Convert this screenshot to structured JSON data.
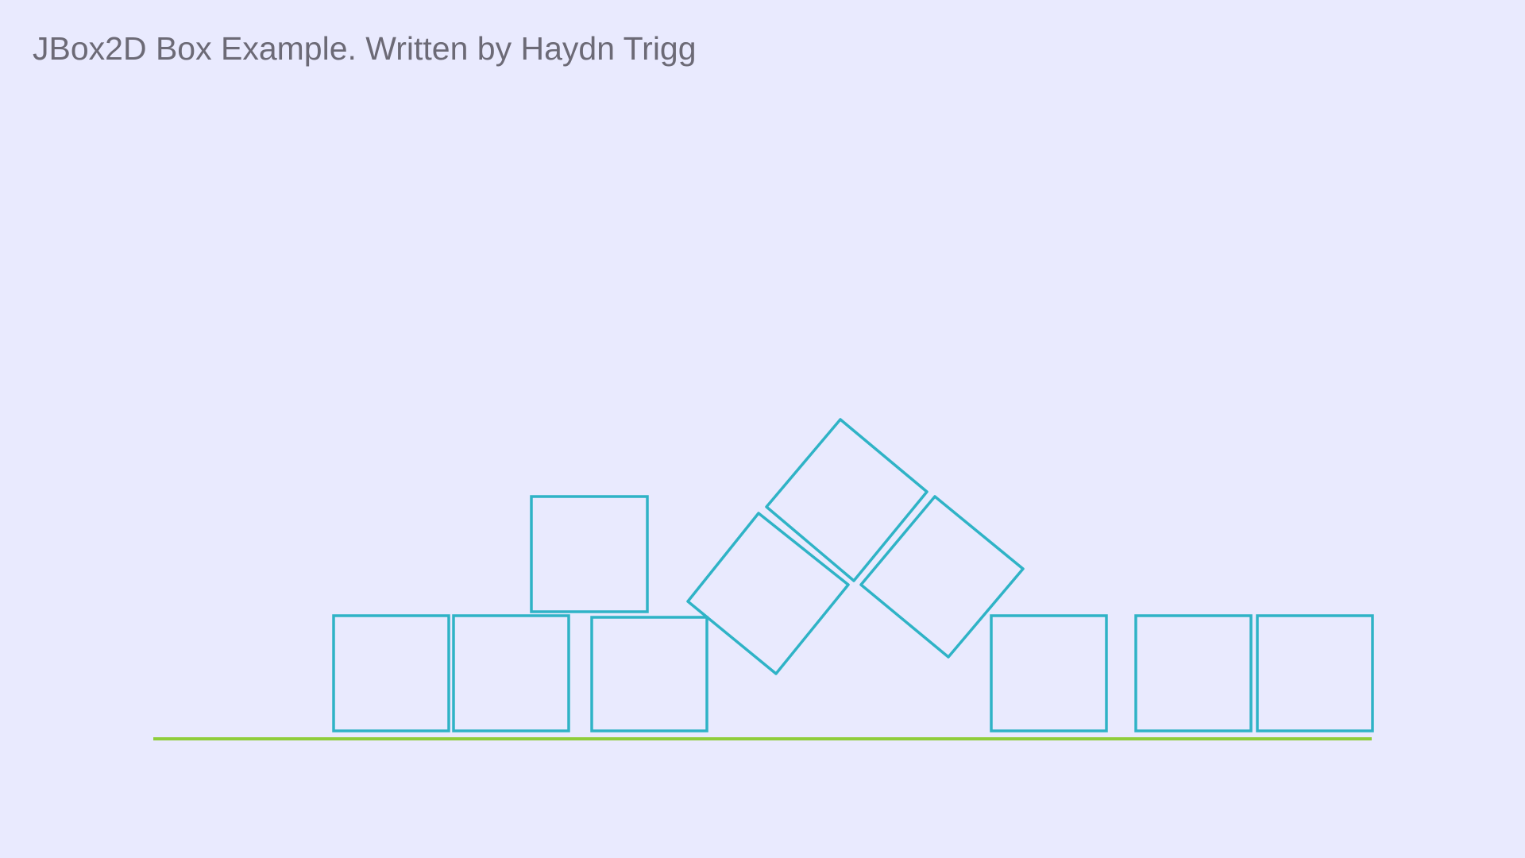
{
  "header": {
    "title": "JBox2D Box Example. Written by Haydn Trigg"
  },
  "colors": {
    "background": "#e9eafe",
    "title_text": "#6c6a76",
    "box_outline": "#2fb3c6",
    "ground_line": "#8fcd3a"
  },
  "scene": {
    "ground": {
      "name": "ground-line"
    },
    "boxes": [
      {
        "name": "box-1"
      },
      {
        "name": "box-2"
      },
      {
        "name": "box-3-stacked"
      },
      {
        "name": "box-4"
      },
      {
        "name": "box-5-tilted"
      },
      {
        "name": "box-6-tilted-top"
      },
      {
        "name": "box-7-tilted"
      },
      {
        "name": "box-8"
      },
      {
        "name": "box-9"
      },
      {
        "name": "box-10"
      }
    ]
  }
}
